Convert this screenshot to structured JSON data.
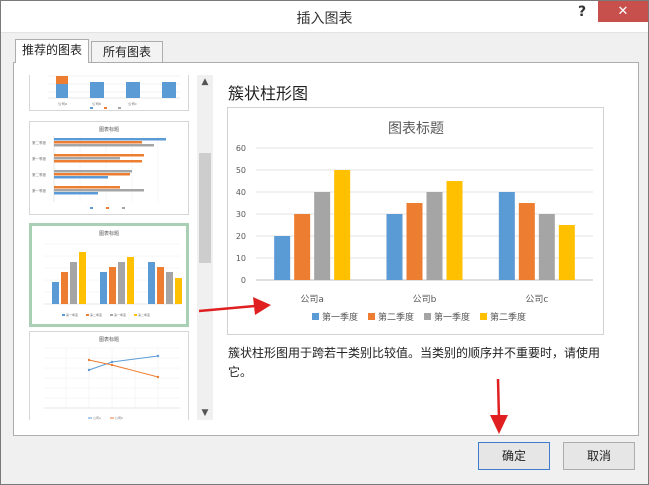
{
  "dialog": {
    "title": "插入图表",
    "help_label": "?",
    "close_label": "✕"
  },
  "tabs": [
    {
      "label": "推荐的图表",
      "active": true
    },
    {
      "label": "所有图表",
      "active": false
    }
  ],
  "thumbnails": [
    {
      "title": "",
      "legend": [
        "公司a",
        "公司b",
        "公司c"
      ]
    },
    {
      "title": "图表标题",
      "rows": [
        "第二季度",
        "第一季度",
        "第二季度",
        "第一季度"
      ]
    },
    {
      "title": "图表标题",
      "legend": [
        "第一季度",
        "第二季度",
        "第一季度",
        "第二季度"
      ]
    },
    {
      "title": "图表标题",
      "legend": [
        "公司a",
        "公司b"
      ]
    }
  ],
  "preview": {
    "heading": "簇状柱形图",
    "description": "簇状柱形图用于跨若干类别比较值。当类别的顺序并不重要时，请使用它。"
  },
  "chart_data": {
    "type": "bar",
    "title": "图表标题",
    "categories": [
      "公司a",
      "公司b",
      "公司c"
    ],
    "series": [
      {
        "name": "第一季度",
        "values": [
          20,
          30,
          40
        ],
        "color": "#5b9bd5"
      },
      {
        "name": "第二季度",
        "values": [
          30,
          35,
          35
        ],
        "color": "#ed7d31"
      },
      {
        "name": "第一季度",
        "values": [
          40,
          40,
          30
        ],
        "color": "#a5a5a5"
      },
      {
        "name": "第二季度",
        "values": [
          50,
          45,
          25
        ],
        "color": "#ffc000"
      }
    ],
    "ylim": [
      0,
      60
    ],
    "yticks": [
      "0",
      "10",
      "20",
      "30",
      "40",
      "50",
      "60"
    ],
    "grid": true,
    "legend": "bottom"
  },
  "buttons": {
    "ok": "确定",
    "cancel": "取消"
  },
  "colors": {
    "blue": "#5b9bd5",
    "orange": "#ed7d31",
    "gray": "#a5a5a5",
    "yellow": "#ffc000",
    "arrow_red": "#e02020",
    "selected_border": "#a9cfb4",
    "close_red": "#c7504d"
  }
}
